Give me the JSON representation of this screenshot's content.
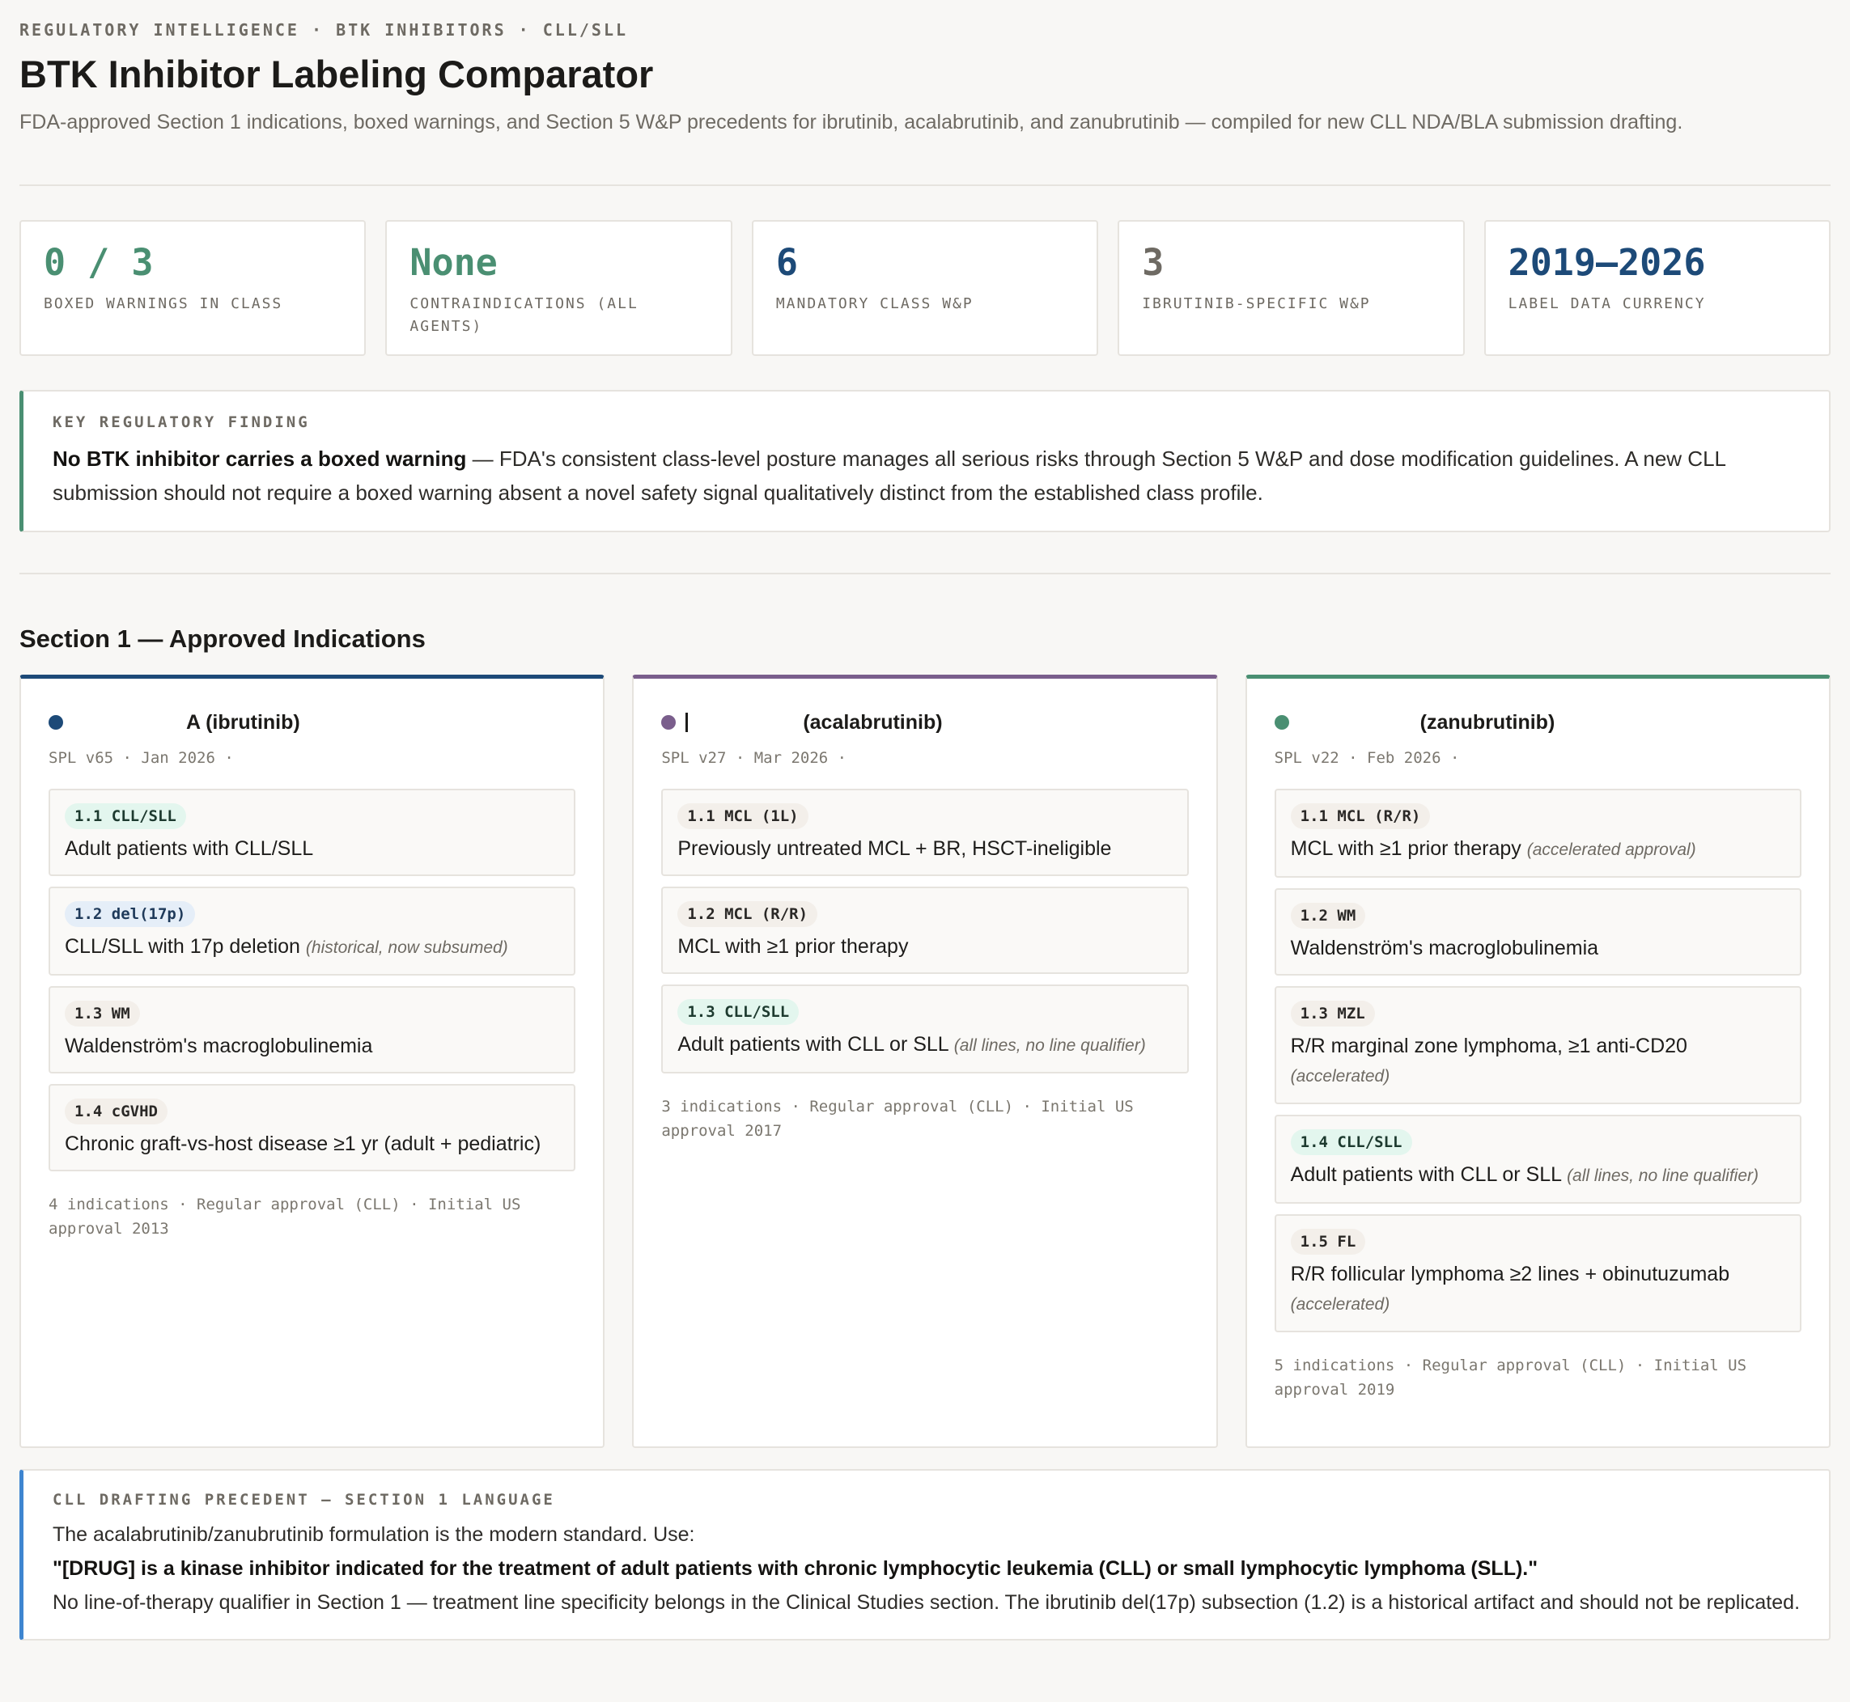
{
  "header": {
    "eyebrow": "REGULATORY INTELLIGENCE · BTK INHIBITORS · CLL/SLL",
    "title": "BTK Inhibitor Labeling Comparator",
    "subtitle": "FDA-approved Section 1 indications, boxed warnings, and Section 5 W&P precedents for ibrutinib, acalabrutinib, and zanubrutinib — compiled for new CLL NDA/BLA submission drafting."
  },
  "stats": [
    {
      "value": "0 / 3",
      "label": "BOXED WARNINGS IN CLASS",
      "color": "#4a8f72"
    },
    {
      "value": "None",
      "label": "CONTRAINDICATIONS (ALL AGENTS)",
      "color": "#4a8f72"
    },
    {
      "value": "6",
      "label": "MANDATORY CLASS W&P",
      "color": "#1d4a78"
    },
    {
      "value": "3",
      "label": "IBRUTINIB-SPECIFIC W&P",
      "color": "#6e6a63"
    },
    {
      "value": "2019–2026",
      "label": "LABEL DATA CURRENCY",
      "color": "#1d4a78"
    }
  ],
  "finding": {
    "eyebrow": "KEY REGULATORY FINDING",
    "bold": "No BTK inhibitor carries a boxed warning",
    "text": " — FDA's consistent class-level posture manages all serious risks through Section 5 W&P and dose modification guidelines. A new CLL submission should not require a boxed warning absent a novel safety signal qualitatively distinct from the established class profile."
  },
  "section1": {
    "title": "Section 1 — Approved Indications",
    "columns": [
      {
        "name_visible": "A (ibrutinib)",
        "color": "#1d4a78",
        "meta": "SPL v65 · Jan 2026 ·",
        "indications": [
          {
            "tag": "1.1 CLL/SLL",
            "text": "Adult patients with CLL/SLL",
            "note": ""
          },
          {
            "tag": "1.2 del(17p)",
            "text": "CLL/SLL with 17p deletion",
            "note": "(historical, now subsumed)"
          },
          {
            "tag": "1.3 WM",
            "text": "Waldenström's macroglobulinemia",
            "note": ""
          },
          {
            "tag": "1.4 cGVHD",
            "text": "Chronic graft-vs-host disease ≥1 yr (adult + pediatric)",
            "note": ""
          }
        ],
        "footer": "4 indications · Regular approval (CLL) · Initial US approval 2013"
      },
      {
        "name_visible": "(acalabrutinib)",
        "color": "#7a5e8c",
        "meta": "SPL v27 · Mar 2026 ·",
        "indications": [
          {
            "tag": "1.1 MCL (1L)",
            "text": "Previously untreated MCL + BR, HSCT-ineligible",
            "note": ""
          },
          {
            "tag": "1.2 MCL (R/R)",
            "text": "MCL with ≥1 prior therapy",
            "note": ""
          },
          {
            "tag": "1.3 CLL/SLL",
            "text": "Adult patients with CLL or SLL",
            "note": "(all lines, no line qualifier)"
          }
        ],
        "footer": "3 indications · Regular approval (CLL) · Initial US approval 2017"
      },
      {
        "name_visible": "(zanubrutinib)",
        "color": "#4a8f72",
        "meta": "SPL v22 · Feb 2026 ·",
        "indications": [
          {
            "tag": "1.1 MCL (R/R)",
            "text": "MCL with ≥1 prior therapy",
            "note": "(accelerated approval)"
          },
          {
            "tag": "1.2 WM",
            "text": "Waldenström's macroglobulinemia",
            "note": ""
          },
          {
            "tag": "1.3 MZL",
            "text": "R/R marginal zone lymphoma, ≥1 anti-CD20",
            "note": "(accelerated)"
          },
          {
            "tag": "1.4 CLL/SLL",
            "text": "Adult patients with CLL or SLL",
            "note": "(all lines, no line qualifier)"
          },
          {
            "tag": "1.5 FL",
            "text": "R/R follicular lymphoma ≥2 lines + obinutuzumab",
            "note": "(accelerated)"
          }
        ],
        "footer": "5 indications · Regular approval (CLL) · Initial US approval 2019"
      }
    ]
  },
  "precedent": {
    "eyebrow": "CLL DRAFTING PRECEDENT — SECTION 1 LANGUAGE",
    "intro": "The acalabrutinib/zanubrutinib formulation is the modern standard. Use:",
    "quote": "\"[DRUG] is a kinase inhibitor indicated for the treatment of adult patients with chronic lymphocytic leukemia (CLL) or small lymphocytic lymphoma (SLL).\"",
    "outro": "No line-of-therapy qualifier in Section 1 — treatment line specificity belongs in the Clinical Studies section. The ibrutinib del(17p) subsection (1.2) is a historical artifact and should not be replicated."
  }
}
